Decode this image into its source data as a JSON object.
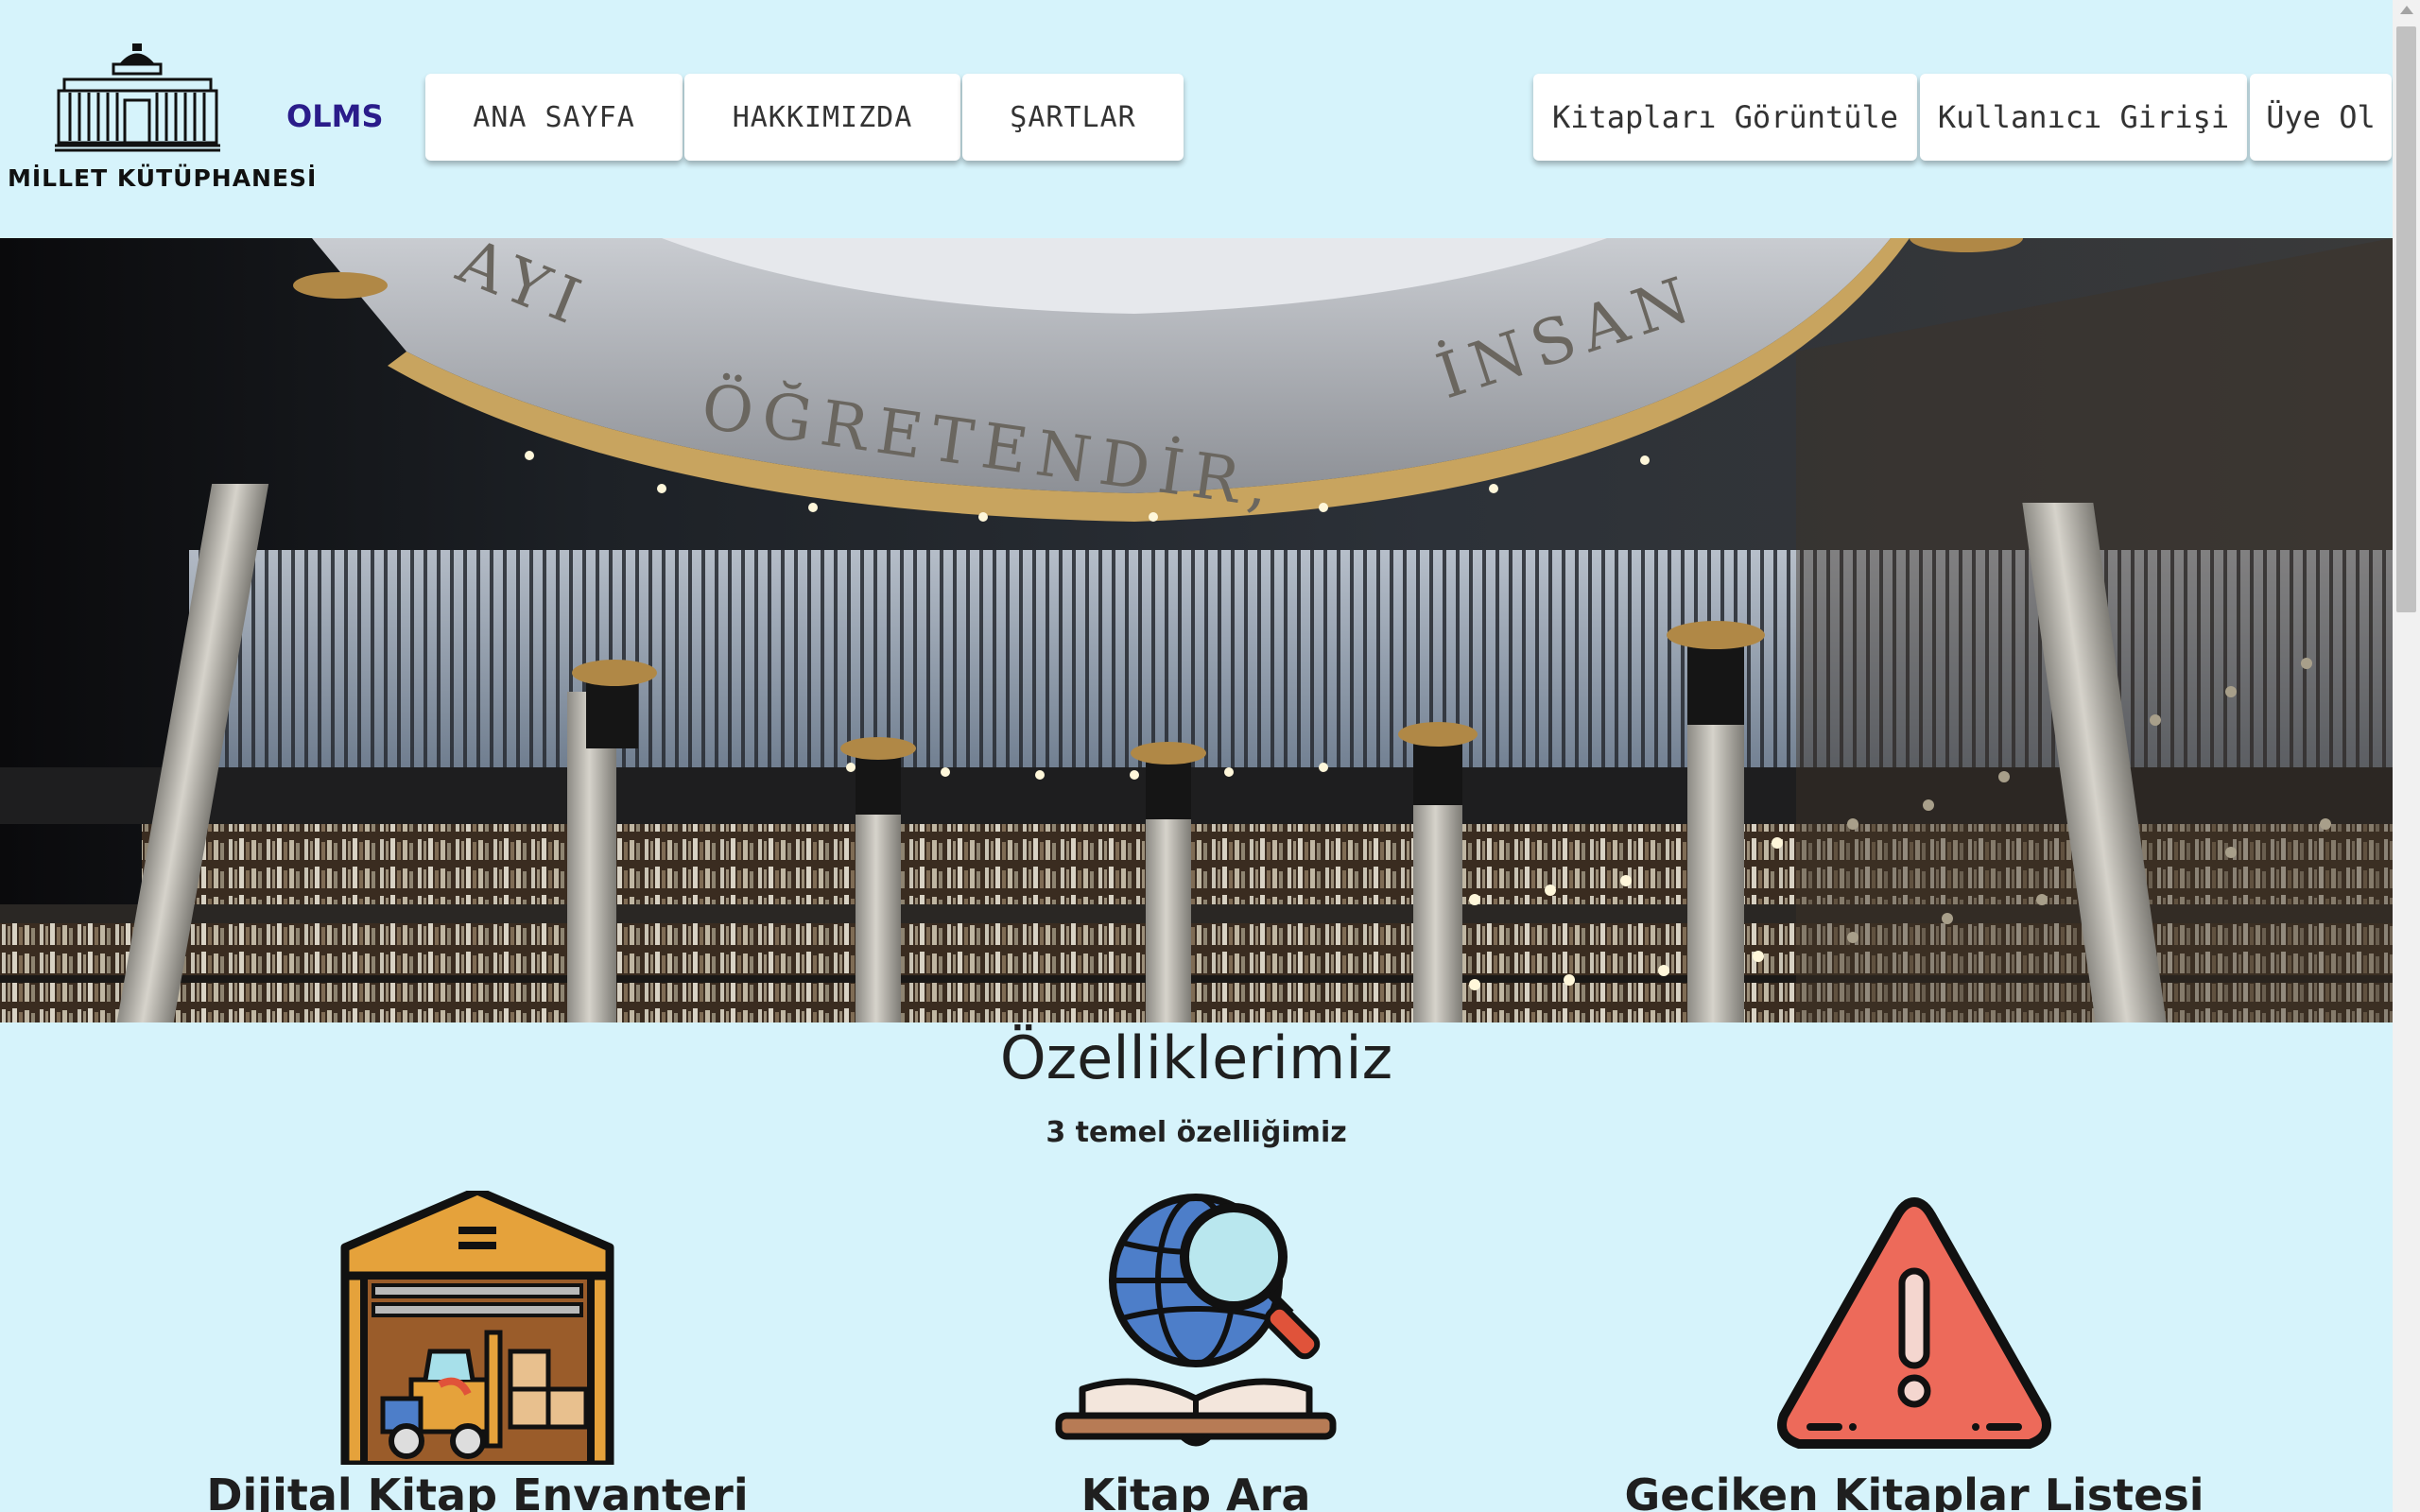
{
  "header": {
    "logo_text": "MİLLET KÜTÜPHANESİ",
    "brand": "OLMS",
    "nav_left": [
      "ANA SAYFA",
      "HAKKIMIZDA",
      "ŞARTLAR"
    ],
    "nav_right": [
      "Kitapları Görüntüle",
      "Kullanıcı Girişi",
      "Üye Ol"
    ]
  },
  "hero": {
    "dome_inscription": "AYI ÖĞRETENDİR, İNSAN"
  },
  "features": {
    "title": "Özelliklerimiz",
    "subtitle": "3 temel özelliğimiz",
    "items": [
      {
        "label": "Dijital Kitap Envanteri",
        "icon": "warehouse-forklift-icon"
      },
      {
        "label": "Kitap Ara",
        "icon": "globe-book-search-icon"
      },
      {
        "label": "Geciken Kitaplar Listesi",
        "icon": "warning-triangle-icon"
      }
    ]
  },
  "colors": {
    "page_background": "#d6f3fb",
    "brand": "#2a1c8a",
    "button_background": "#ffffff"
  }
}
